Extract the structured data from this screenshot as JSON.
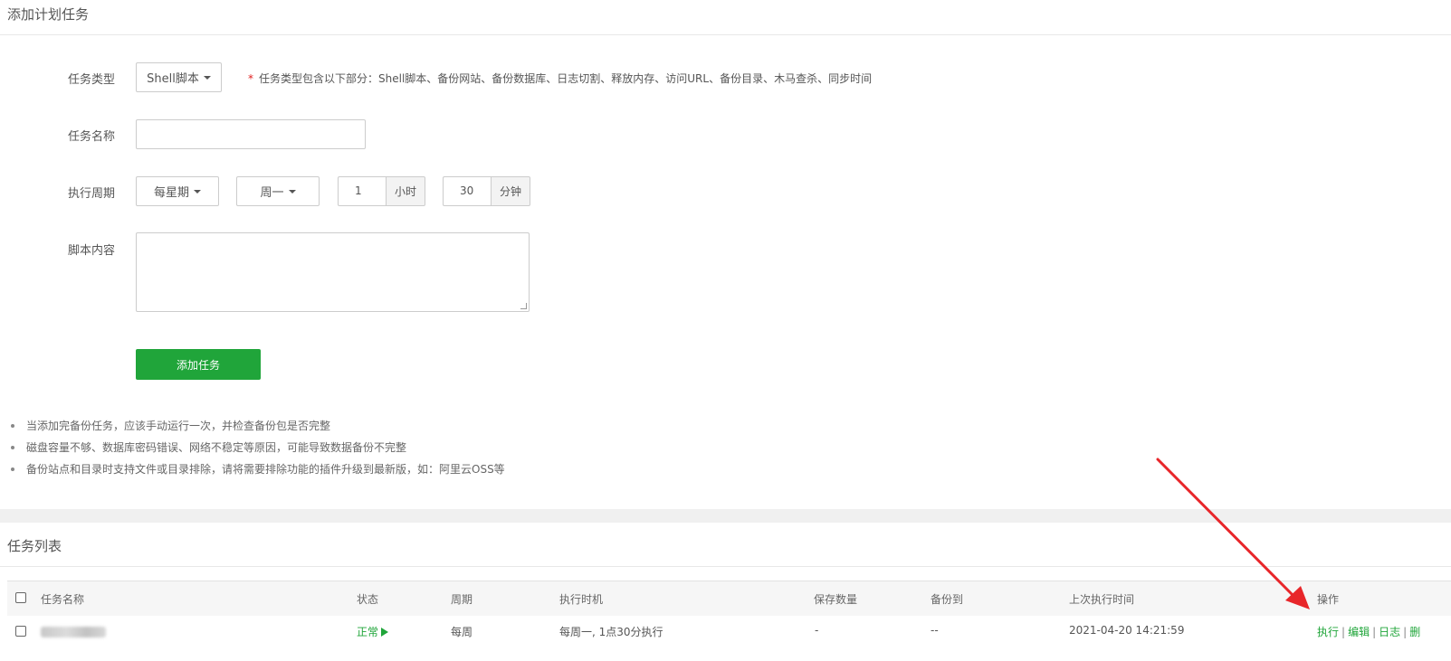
{
  "form": {
    "title": "添加计划任务",
    "type_label": "任务类型",
    "type_value": "Shell脚本",
    "type_hint_star": "*",
    "type_hint": "任务类型包含以下部分：Shell脚本、备份网站、备份数据库、日志切割、释放内存、访问URL、备份目录、木马查杀、同步时间",
    "name_label": "任务名称",
    "name_value": "",
    "period_label": "执行周期",
    "period_value": "每星期",
    "weekday_value": "周一",
    "hour_value": "1",
    "hour_unit": "小时",
    "minute_value": "30",
    "minute_unit": "分钟",
    "script_label": "脚本内容",
    "script_value": "",
    "submit_label": "添加任务"
  },
  "tips": [
    "当添加完备份任务，应该手动运行一次，并检查备份包是否完整",
    "磁盘容量不够、数据库密码错误、网络不稳定等原因，可能导致数据备份不完整",
    "备份站点和目录时支持文件或目录排除，请将需要排除功能的插件升级到最新版，如：阿里云OSS等"
  ],
  "list": {
    "title": "任务列表",
    "columns": {
      "name": "任务名称",
      "status": "状态",
      "period": "周期",
      "exec_time": "执行时机",
      "keep": "保存数量",
      "backup_to": "备份到",
      "last_run": "上次执行时间",
      "ops": "操作"
    },
    "rows": [
      {
        "status": "正常",
        "period": "每周",
        "exec_time": "每周一, 1点30分执行",
        "keep": "-",
        "backup_to": "--",
        "last_run": "2021-04-20 14:21:59",
        "ops": [
          "执行",
          "编辑",
          "日志",
          "删"
        ]
      }
    ]
  },
  "colors": {
    "accent": "#20a53a",
    "annotation_arrow": "#e8262a",
    "required_star": "#e02020"
  }
}
